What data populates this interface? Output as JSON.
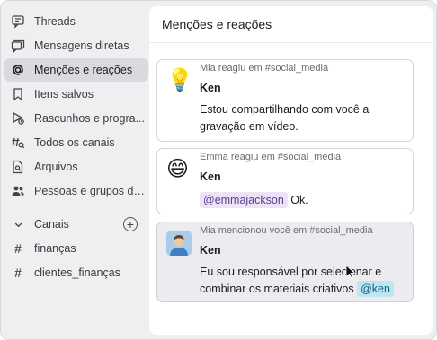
{
  "sidebar": {
    "items": [
      {
        "label": "Threads",
        "icon": "threads-icon"
      },
      {
        "label": "Mensagens diretas",
        "icon": "direct-messages-icon"
      },
      {
        "label": "Menções e reações",
        "icon": "at-sign-icon",
        "active": true
      },
      {
        "label": "Itens salvos",
        "icon": "bookmark-icon"
      },
      {
        "label": "Rascunhos e progra...",
        "icon": "drafts-icon"
      },
      {
        "label": "Todos os canais",
        "icon": "channel-search-icon"
      },
      {
        "label": "Arquivos",
        "icon": "files-icon"
      },
      {
        "label": "Pessoas e grupos de...",
        "icon": "people-icon"
      }
    ],
    "channels_label": "Canais",
    "channels": [
      {
        "label": "finanças"
      },
      {
        "label": "clientes_finanças"
      }
    ]
  },
  "main": {
    "title": "Menções e reações",
    "cards": [
      {
        "meta": "Mia reagiu em #social_media",
        "author": "Ken",
        "line1": "Estou compartilhando com você a",
        "line2": "gravação em vídeo.",
        "avatar": "💡"
      },
      {
        "meta": "Emma reagiu em #social_media",
        "author": "Ken",
        "mention": "@emmajackson",
        "after_mention": " Ok.",
        "avatar": "😄"
      },
      {
        "meta": "Mia mencionou você em #social_media",
        "author": "Ken",
        "line1": "Eu sou responsável por selecionar e",
        "line2": "combinar os materiais criativos",
        "mention": "@ken"
      }
    ]
  },
  "colors": {
    "sidebar_bg": "#efeff1",
    "active_item_bg": "#d9dadf",
    "highlight_card_bg": "#ececf0",
    "mention_purple_bg": "#ece3f7",
    "mention_blue_bg": "#bde6f3"
  }
}
